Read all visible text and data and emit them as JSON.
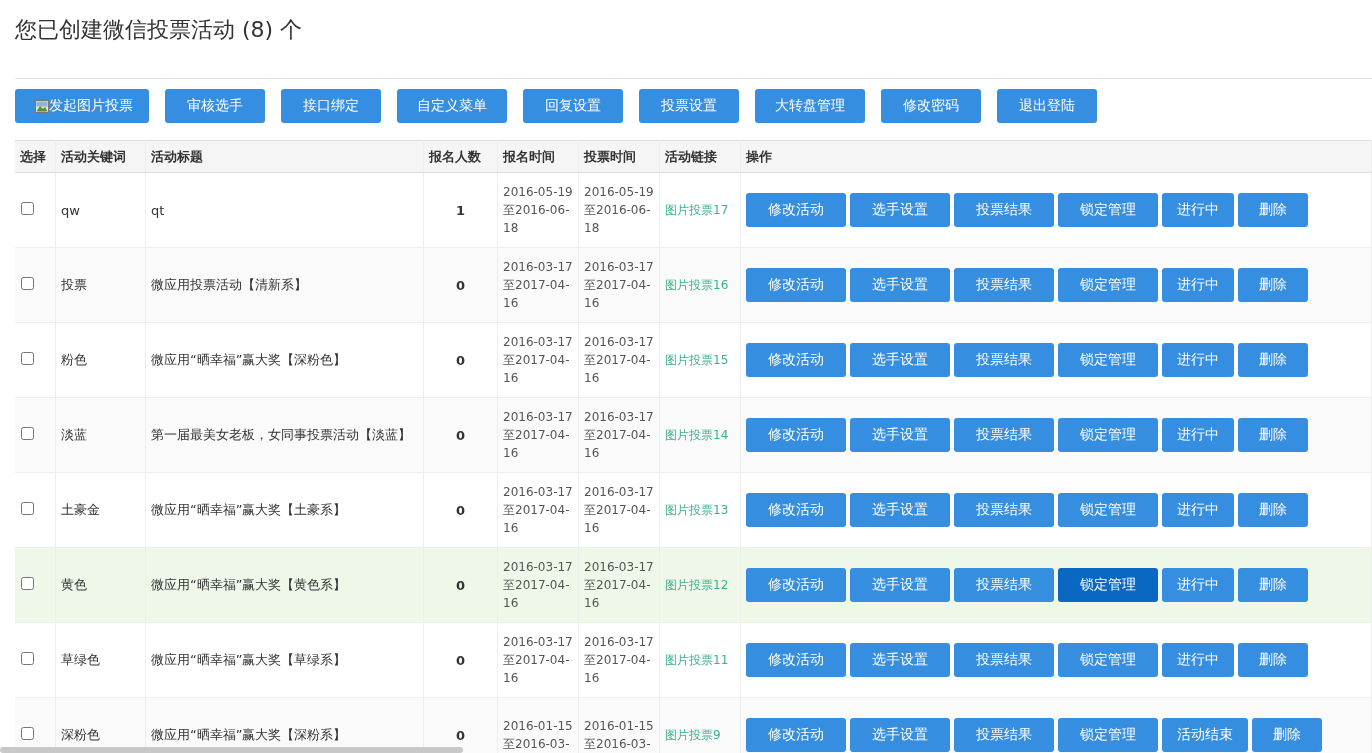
{
  "title": "您已创建微信投票活动 (8) 个",
  "toolbar": [
    {
      "label": "发起图片投票",
      "kind": "image"
    },
    {
      "label": "审核选手",
      "kind": "plain"
    },
    {
      "label": "接口绑定",
      "kind": "plain"
    },
    {
      "label": "自定义菜单",
      "kind": "plain"
    },
    {
      "label": "回复设置",
      "kind": "plain"
    },
    {
      "label": "投票设置",
      "kind": "plain"
    },
    {
      "label": "大转盘管理",
      "kind": "plain"
    },
    {
      "label": "修改密码",
      "kind": "plain"
    },
    {
      "label": "退出登陆",
      "kind": "plain"
    }
  ],
  "table": {
    "columns": [
      "选择",
      "活动关键词",
      "活动标题",
      "报名人数",
      "报名时间",
      "投票时间",
      "活动链接",
      "操作"
    ],
    "rows": [
      {
        "checked": false,
        "highlighted": false,
        "keyword": "qw",
        "title": "qt",
        "count": "1",
        "signup_time": "2016-05-19至2016-06-18",
        "vote_time": "2016-05-19至2016-06-18",
        "link": "图片投票17",
        "actions": [
          {
            "label": "修改活动",
            "active": false
          },
          {
            "label": "选手设置",
            "active": false
          },
          {
            "label": "投票结果",
            "active": false
          },
          {
            "label": "锁定管理",
            "active": false
          },
          {
            "label": "进行中",
            "active": false
          },
          {
            "label": "删除",
            "active": false
          }
        ]
      },
      {
        "checked": false,
        "highlighted": false,
        "keyword": "投票",
        "title": "微应用投票活动【清新系】",
        "count": "0",
        "signup_time": "2016-03-17至2017-04-16",
        "vote_time": "2016-03-17至2017-04-16",
        "link": "图片投票16",
        "actions": [
          {
            "label": "修改活动",
            "active": false
          },
          {
            "label": "选手设置",
            "active": false
          },
          {
            "label": "投票结果",
            "active": false
          },
          {
            "label": "锁定管理",
            "active": false
          },
          {
            "label": "进行中",
            "active": false
          },
          {
            "label": "删除",
            "active": false
          }
        ]
      },
      {
        "checked": false,
        "highlighted": false,
        "keyword": "粉色",
        "title": "微应用“晒幸福”赢大奖【深粉色】",
        "count": "0",
        "signup_time": "2016-03-17至2017-04-16",
        "vote_time": "2016-03-17至2017-04-16",
        "link": "图片投票15",
        "actions": [
          {
            "label": "修改活动",
            "active": false
          },
          {
            "label": "选手设置",
            "active": false
          },
          {
            "label": "投票结果",
            "active": false
          },
          {
            "label": "锁定管理",
            "active": false
          },
          {
            "label": "进行中",
            "active": false
          },
          {
            "label": "删除",
            "active": false
          }
        ]
      },
      {
        "checked": false,
        "highlighted": false,
        "keyword": "淡蓝",
        "title": "第一届最美女老板，女同事投票活动【淡蓝】",
        "count": "0",
        "signup_time": "2016-03-17至2017-04-16",
        "vote_time": "2016-03-17至2017-04-16",
        "link": "图片投票14",
        "actions": [
          {
            "label": "修改活动",
            "active": false
          },
          {
            "label": "选手设置",
            "active": false
          },
          {
            "label": "投票结果",
            "active": false
          },
          {
            "label": "锁定管理",
            "active": false
          },
          {
            "label": "进行中",
            "active": false
          },
          {
            "label": "删除",
            "active": false
          }
        ]
      },
      {
        "checked": false,
        "highlighted": false,
        "keyword": "土豪金",
        "title": "微应用“晒幸福”赢大奖【土豪系】",
        "count": "0",
        "signup_time": "2016-03-17至2017-04-16",
        "vote_time": "2016-03-17至2017-04-16",
        "link": "图片投票13",
        "actions": [
          {
            "label": "修改活动",
            "active": false
          },
          {
            "label": "选手设置",
            "active": false
          },
          {
            "label": "投票结果",
            "active": false
          },
          {
            "label": "锁定管理",
            "active": false
          },
          {
            "label": "进行中",
            "active": false
          },
          {
            "label": "删除",
            "active": false
          }
        ]
      },
      {
        "checked": false,
        "highlighted": true,
        "keyword": "黄色",
        "title": "微应用“晒幸福”赢大奖【黄色系】",
        "count": "0",
        "signup_time": "2016-03-17至2017-04-16",
        "vote_time": "2016-03-17至2017-04-16",
        "link": "图片投票12",
        "actions": [
          {
            "label": "修改活动",
            "active": false
          },
          {
            "label": "选手设置",
            "active": false
          },
          {
            "label": "投票结果",
            "active": false
          },
          {
            "label": "锁定管理",
            "active": true
          },
          {
            "label": "进行中",
            "active": false
          },
          {
            "label": "删除",
            "active": false
          }
        ]
      },
      {
        "checked": false,
        "highlighted": false,
        "keyword": "草绿色",
        "title": "微应用“晒幸福”赢大奖【草绿系】",
        "count": "0",
        "signup_time": "2016-03-17至2017-04-16",
        "vote_time": "2016-03-17至2017-04-16",
        "link": "图片投票11",
        "actions": [
          {
            "label": "修改活动",
            "active": false
          },
          {
            "label": "选手设置",
            "active": false
          },
          {
            "label": "投票结果",
            "active": false
          },
          {
            "label": "锁定管理",
            "active": false
          },
          {
            "label": "进行中",
            "active": false
          },
          {
            "label": "删除",
            "active": false
          }
        ]
      },
      {
        "checked": false,
        "highlighted": false,
        "keyword": "深粉色",
        "title": "微应用“晒幸福”赢大奖【深粉系】",
        "count": "0",
        "signup_time": "2016-01-15至2016-03-",
        "vote_time": "2016-01-15至2016-03-",
        "link": "图片投票9",
        "actions": [
          {
            "label": "修改活动",
            "active": false
          },
          {
            "label": "选手设置",
            "active": false
          },
          {
            "label": "投票结果",
            "active": false
          },
          {
            "label": "锁定管理",
            "active": false
          },
          {
            "label": "活动结束",
            "active": false
          },
          {
            "label": "删除",
            "active": false
          }
        ]
      }
    ]
  }
}
